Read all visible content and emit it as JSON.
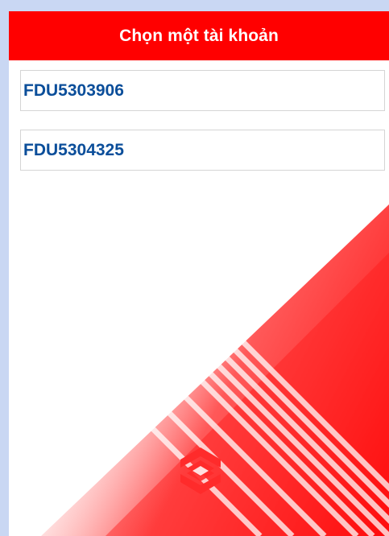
{
  "header": {
    "title": "Chọn một tài khoản"
  },
  "accounts": [
    {
      "label": "FDU5303906"
    },
    {
      "label": "FDU5304325"
    }
  ],
  "colors": {
    "header_bg": "#ff0000",
    "account_text": "#0b4e9a",
    "accent_red": "#ff1a1a",
    "backdrop": "#c9d7f3"
  },
  "logo": {
    "icon": "brand-logo-icon"
  }
}
